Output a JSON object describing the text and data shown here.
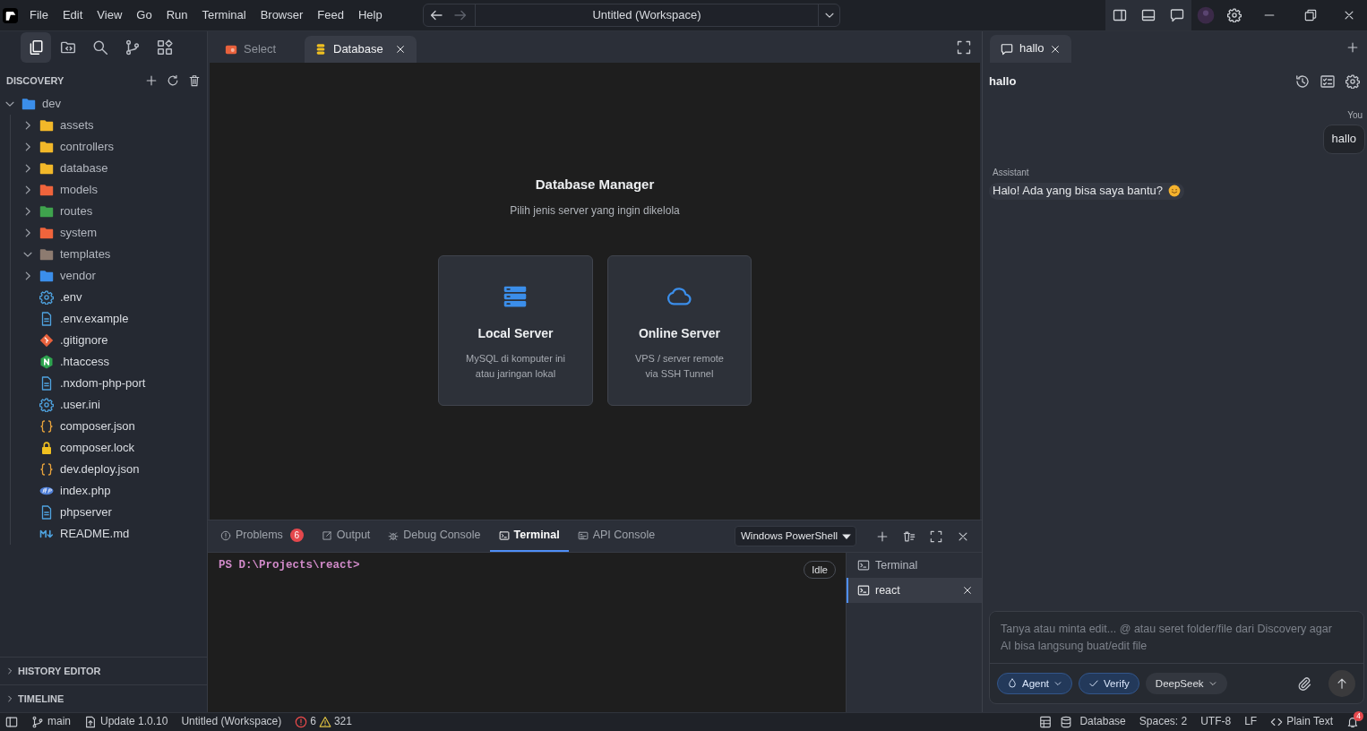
{
  "title_bar": {
    "menus": [
      "File",
      "Edit",
      "View",
      "Go",
      "Run",
      "Terminal",
      "Browser",
      "Feed",
      "Help"
    ],
    "navigation": {
      "can_go_back": true,
      "can_go_forward": false
    },
    "workspace": "Untitled (Workspace)"
  },
  "sidebar": {
    "activity": [
      {
        "kind": "files",
        "selected": true
      },
      {
        "kind": "remote",
        "selected": false
      },
      {
        "kind": "search",
        "selected": false
      },
      {
        "kind": "source-control",
        "selected": false
      },
      {
        "kind": "extensions",
        "selected": false
      }
    ],
    "title": "DISCOVERY",
    "tree": [
      {
        "label": "dev",
        "kind": "folder",
        "color": "#3b8eea",
        "expanded": true,
        "children": [
          {
            "label": "assets",
            "kind": "folder",
            "color": "#f2b829",
            "expanded": false
          },
          {
            "label": "controllers",
            "kind": "folder",
            "color": "#f2b829",
            "expanded": false
          },
          {
            "label": "database",
            "kind": "folder",
            "color": "#f2b829",
            "expanded": false
          },
          {
            "label": "models",
            "kind": "folder",
            "color": "#f0643c",
            "expanded": false
          },
          {
            "label": "routes",
            "kind": "folder",
            "color": "#3fa34d",
            "expanded": false
          },
          {
            "label": "system",
            "kind": "folder",
            "color": "#f0643c",
            "expanded": false
          },
          {
            "label": "templates",
            "kind": "folder",
            "color": "#8d7b70",
            "expanded": true
          },
          {
            "label": "vendor",
            "kind": "folder",
            "color": "#3b8eea",
            "expanded": false
          },
          {
            "label": ".env",
            "kind": "config"
          },
          {
            "label": ".env.example",
            "kind": "document"
          },
          {
            "label": ".gitignore",
            "kind": "git"
          },
          {
            "label": ".htaccess",
            "kind": "nginx"
          },
          {
            "label": ".nxdom-php-port",
            "kind": "document"
          },
          {
            "label": ".user.ini",
            "kind": "config"
          },
          {
            "label": "composer.json",
            "kind": "json"
          },
          {
            "label": "composer.lock",
            "kind": "lock"
          },
          {
            "label": "dev.deploy.json",
            "kind": "json"
          },
          {
            "label": "index.php",
            "kind": "php"
          },
          {
            "label": "phpserver",
            "kind": "document"
          },
          {
            "label": "README.md",
            "kind": "markdown"
          }
        ]
      }
    ],
    "sections": [
      {
        "label": "HISTORY EDITOR",
        "expanded": false
      },
      {
        "label": "TIMELINE",
        "expanded": false
      }
    ]
  },
  "editor": {
    "tabs": [
      {
        "label": "Select",
        "kind": "browser",
        "selected": false
      },
      {
        "label": "Database",
        "kind": "database",
        "selected": true
      }
    ],
    "heading": "Database Manager",
    "subheading": "Pilih jenis server yang ingin dikelola",
    "options": [
      {
        "kind": "server",
        "title": "Local Server",
        "description": "MySQL di komputer ini\natau jaringan lokal"
      },
      {
        "kind": "cloud",
        "title": "Online Server",
        "description": "VPS / server remote\nvia SSH Tunnel"
      }
    ]
  },
  "panel": {
    "tabs": [
      {
        "label": "Problems",
        "kind": "problems",
        "count": "6",
        "selected": false
      },
      {
        "label": "Output",
        "kind": "output",
        "selected": false
      },
      {
        "label": "Debug Console",
        "kind": "debug",
        "selected": false
      },
      {
        "label": "Terminal",
        "kind": "terminal",
        "selected": true
      },
      {
        "label": "API Console",
        "kind": "api",
        "selected": false
      }
    ],
    "shell": "Windows PowerShell",
    "prompt": "PS D:\\Projects\\react>",
    "status": "Idle",
    "terminals": [
      {
        "label": "Terminal",
        "selected": false
      },
      {
        "label": "react",
        "selected": true
      }
    ]
  },
  "chat": {
    "tabs": [
      {
        "label": "hallo",
        "selected": true
      }
    ],
    "title": "hallo",
    "messages": [
      {
        "kind": "user",
        "author": "You",
        "text": "hallo"
      },
      {
        "kind": "assistant",
        "author": "Assistant",
        "text": "Halo! Ada yang bisa saya bantu?"
      }
    ],
    "input": {
      "placeholder": "Tanya atau minta edit... @ atau seret folder/file dari Discovery agar AI bisa langsung buat/edit file"
    },
    "chips": [
      {
        "label": "Agent",
        "kind": "mode",
        "on": true
      },
      {
        "label": "Verify",
        "kind": "toggle",
        "on": true
      },
      {
        "label": "DeepSeek",
        "kind": "model",
        "on": false
      }
    ]
  },
  "status_bar": {
    "branch": "main",
    "update": "Update 1.0.10",
    "workspace": "Untitled (Workspace)",
    "errors": "6",
    "warnings": "321",
    "database": "Database",
    "indentation": "Spaces: 2",
    "encoding": "UTF-8",
    "line_ending": "LF",
    "language": "Plain Text",
    "notifications": "4"
  }
}
